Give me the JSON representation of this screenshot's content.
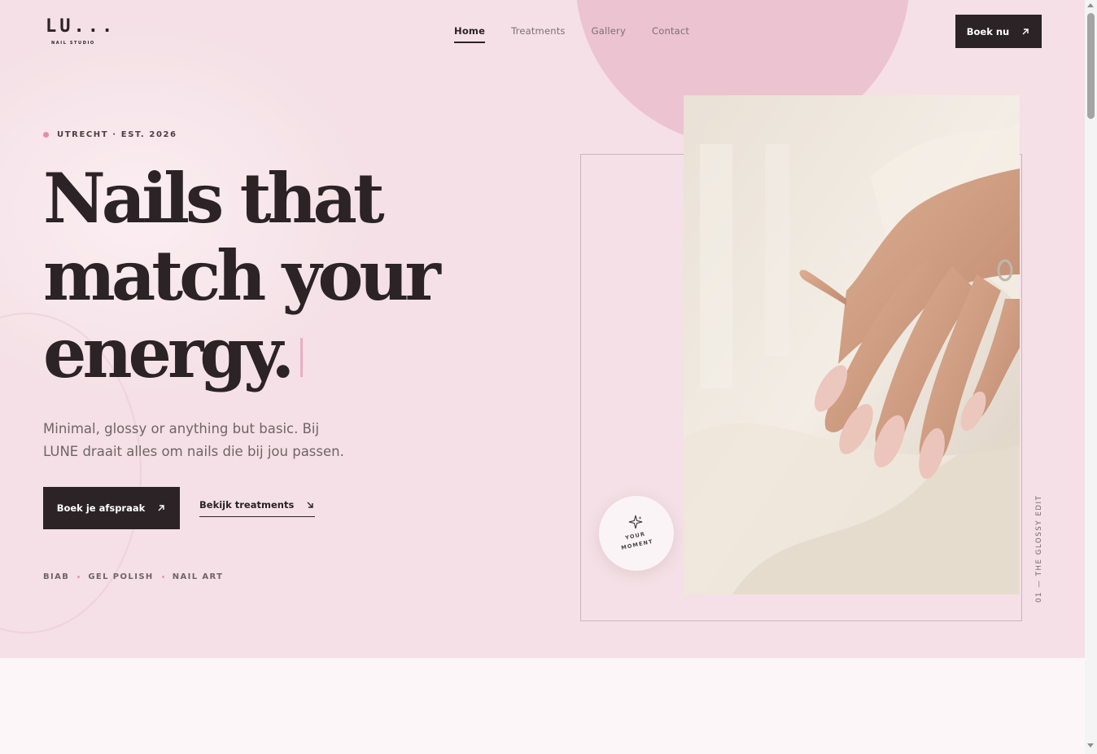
{
  "header": {
    "logo_mark": "LU...",
    "logo_sub": "NAIL STUDIO",
    "nav": [
      {
        "label": "Home",
        "active": true
      },
      {
        "label": "Treatments",
        "active": false
      },
      {
        "label": "Gallery",
        "active": false
      },
      {
        "label": "Contact",
        "active": false
      }
    ],
    "cta_label": "Boek nu"
  },
  "hero": {
    "eyebrow": "UTRECHT · EST. 2026",
    "headline_lines": [
      "Nails that",
      "match your",
      "energy."
    ],
    "subtitle": "Minimal, glossy or anything but basic. Bij LUNE draait alles om nails die bij jou passen.",
    "primary_cta": "Boek je afspraak",
    "secondary_cta": "Bekijk treatments",
    "tags": [
      "BIAB",
      "GEL POLISH",
      "NAIL ART"
    ]
  },
  "visual": {
    "badge_lines": [
      "YOUR",
      "MOMENT"
    ],
    "side_label": "01 — THE GLOSSY EDIT"
  },
  "icons": {
    "cta_arrow": "arrow-up-right-icon",
    "secondary_arrow": "arrow-down-right-icon",
    "badge_icon": "sparkle-icon"
  },
  "colors": {
    "background": "#f4e0e6",
    "accent_pink": "#ecc3d0",
    "dark": "#2b2325",
    "dot": "#e58da8"
  }
}
